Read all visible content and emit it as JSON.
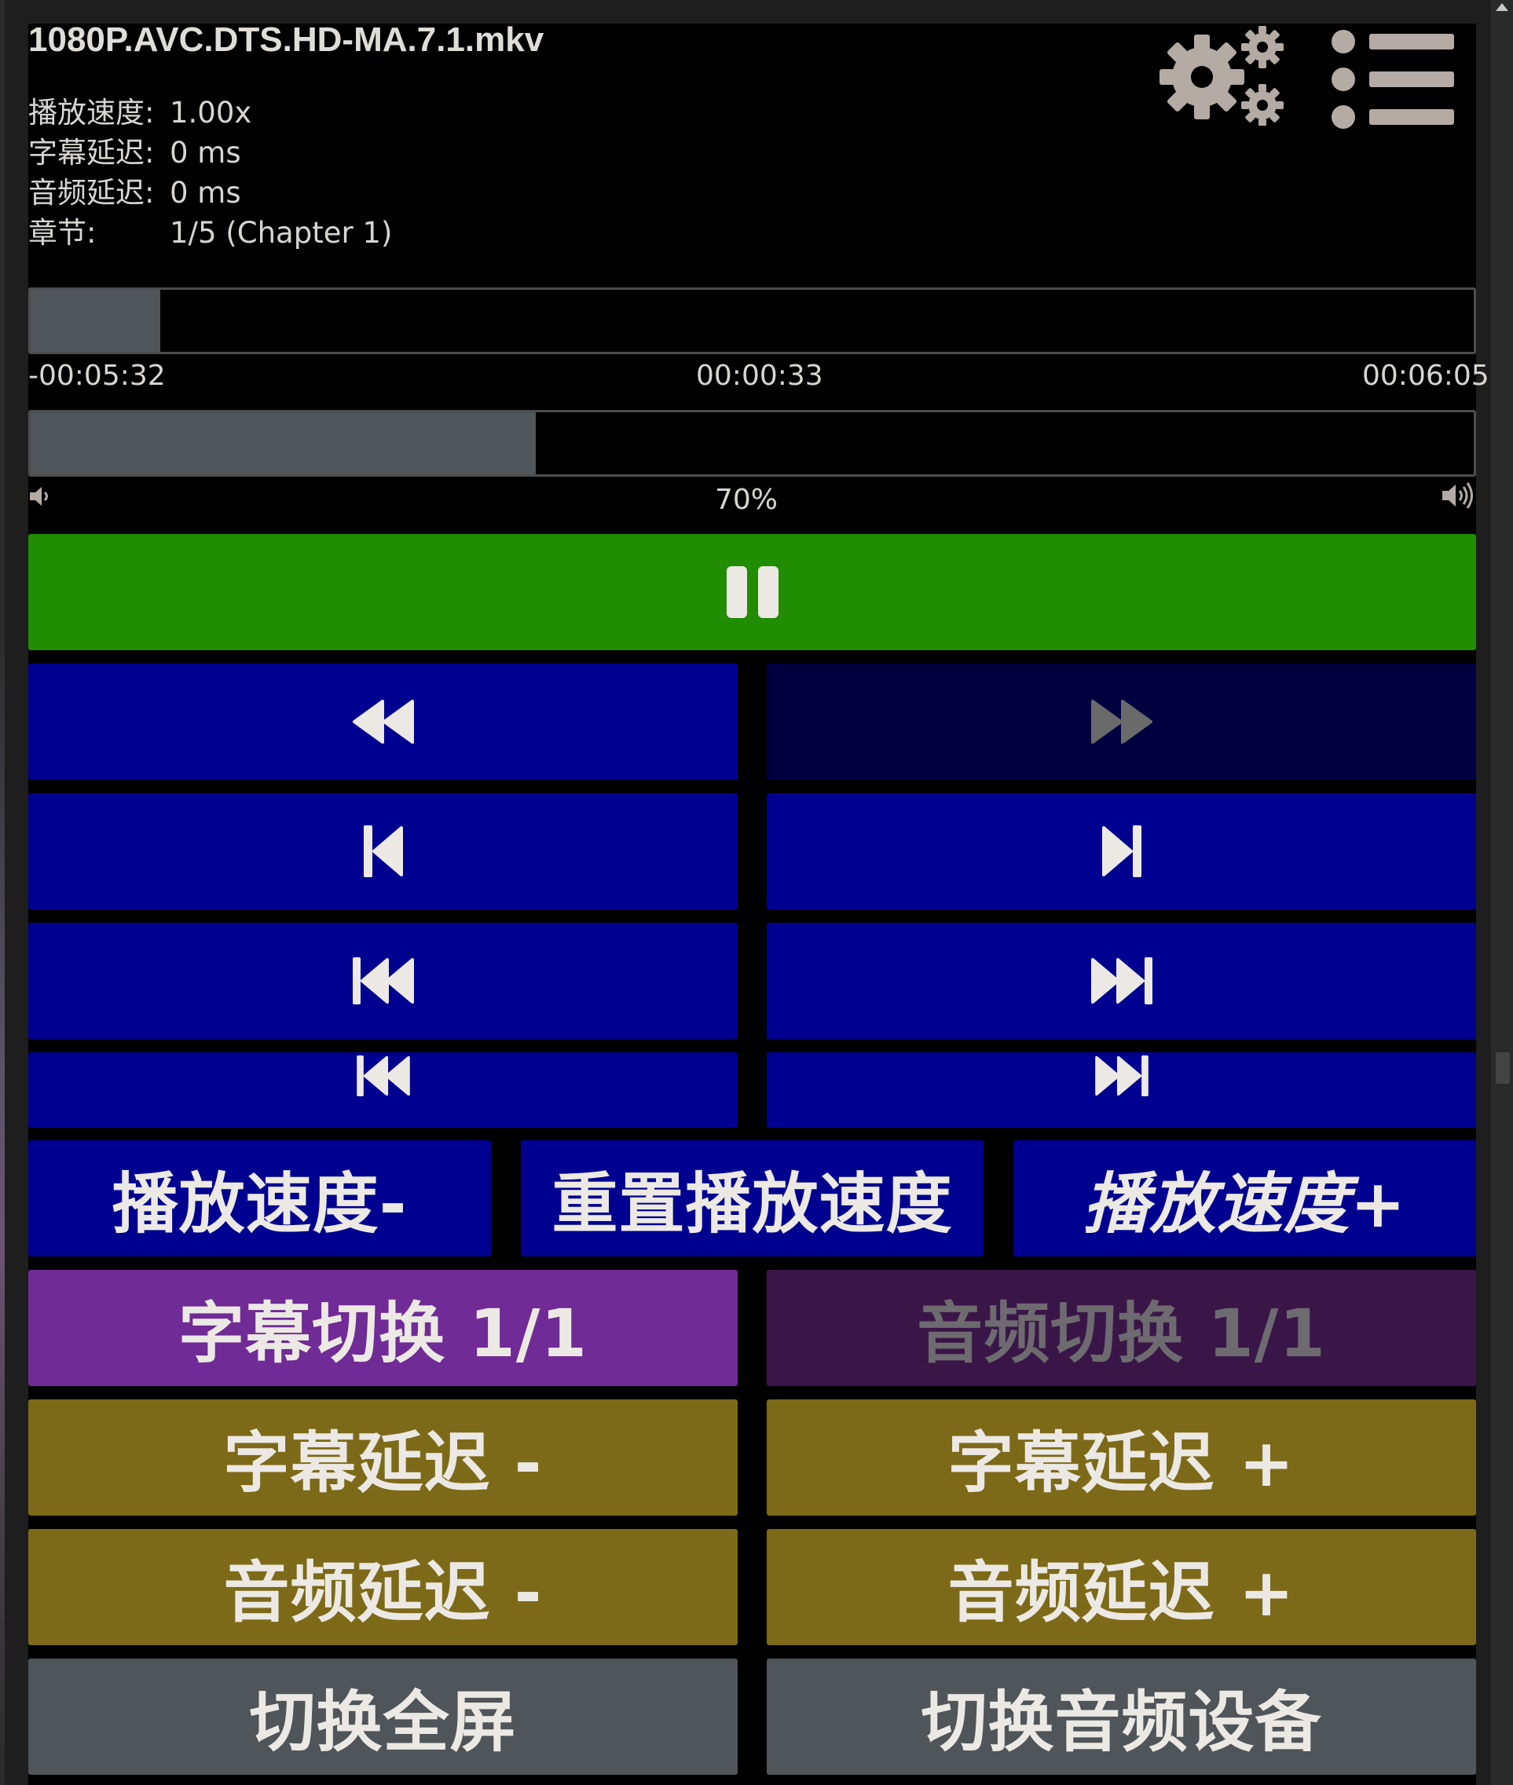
{
  "file": {
    "title": "1080P.AVC.DTS.HD-MA.7.1.mkv"
  },
  "info": [
    {
      "label": "播放速度:",
      "value": "1.00x"
    },
    {
      "label": "字幕延迟:",
      "value": "0 ms"
    },
    {
      "label": "音频延迟:",
      "value": "0 ms"
    },
    {
      "label": "章节:",
      "value": "1/5 (Chapter 1)"
    }
  ],
  "header_icons": {
    "settings": "gears-icon",
    "menu": "list-menu-icon"
  },
  "seek": {
    "progress": 0.09,
    "remaining": "-00:05:32",
    "position": "00:00:33",
    "duration": "00:06:05"
  },
  "volume": {
    "level": 0.35,
    "label": "70%",
    "low_icon": "volume-low-icon",
    "high_icon": "volume-high-icon"
  },
  "controls": {
    "play_pause_icon": "pause-icon",
    "rewind_icon": "rewind-icon",
    "fast_forward_icon": "fast-forward-icon",
    "prev_chapter_icon": "step-backward-icon",
    "next_chapter_icon": "step-forward-icon",
    "prev_file_icon": "fast-backward-icon",
    "next_file_icon": "fast-forward-end-icon"
  },
  "buttons": {
    "speed_down": "播放速度-",
    "speed_reset": "重置播放速度",
    "speed_up": "播放速度+",
    "subtitle_cycle": "字幕切换 1/1",
    "audio_cycle": "音频切换 1/1",
    "sub_delay_down": "字幕延迟 -",
    "sub_delay_up": "字幕延迟 +",
    "audio_delay_down": "音频延迟 -",
    "audio_delay_up": "音频延迟 +",
    "fullscreen": "切换全屏",
    "audio_device": "切换音频设备"
  },
  "colors": {
    "play": "#218d02",
    "nav": "#000090",
    "nav_disabled": "#000040",
    "subtitle": "#702b96",
    "audio_disabled": "#3a1648",
    "delay": "#7d6a18",
    "misc": "#4f5559"
  }
}
